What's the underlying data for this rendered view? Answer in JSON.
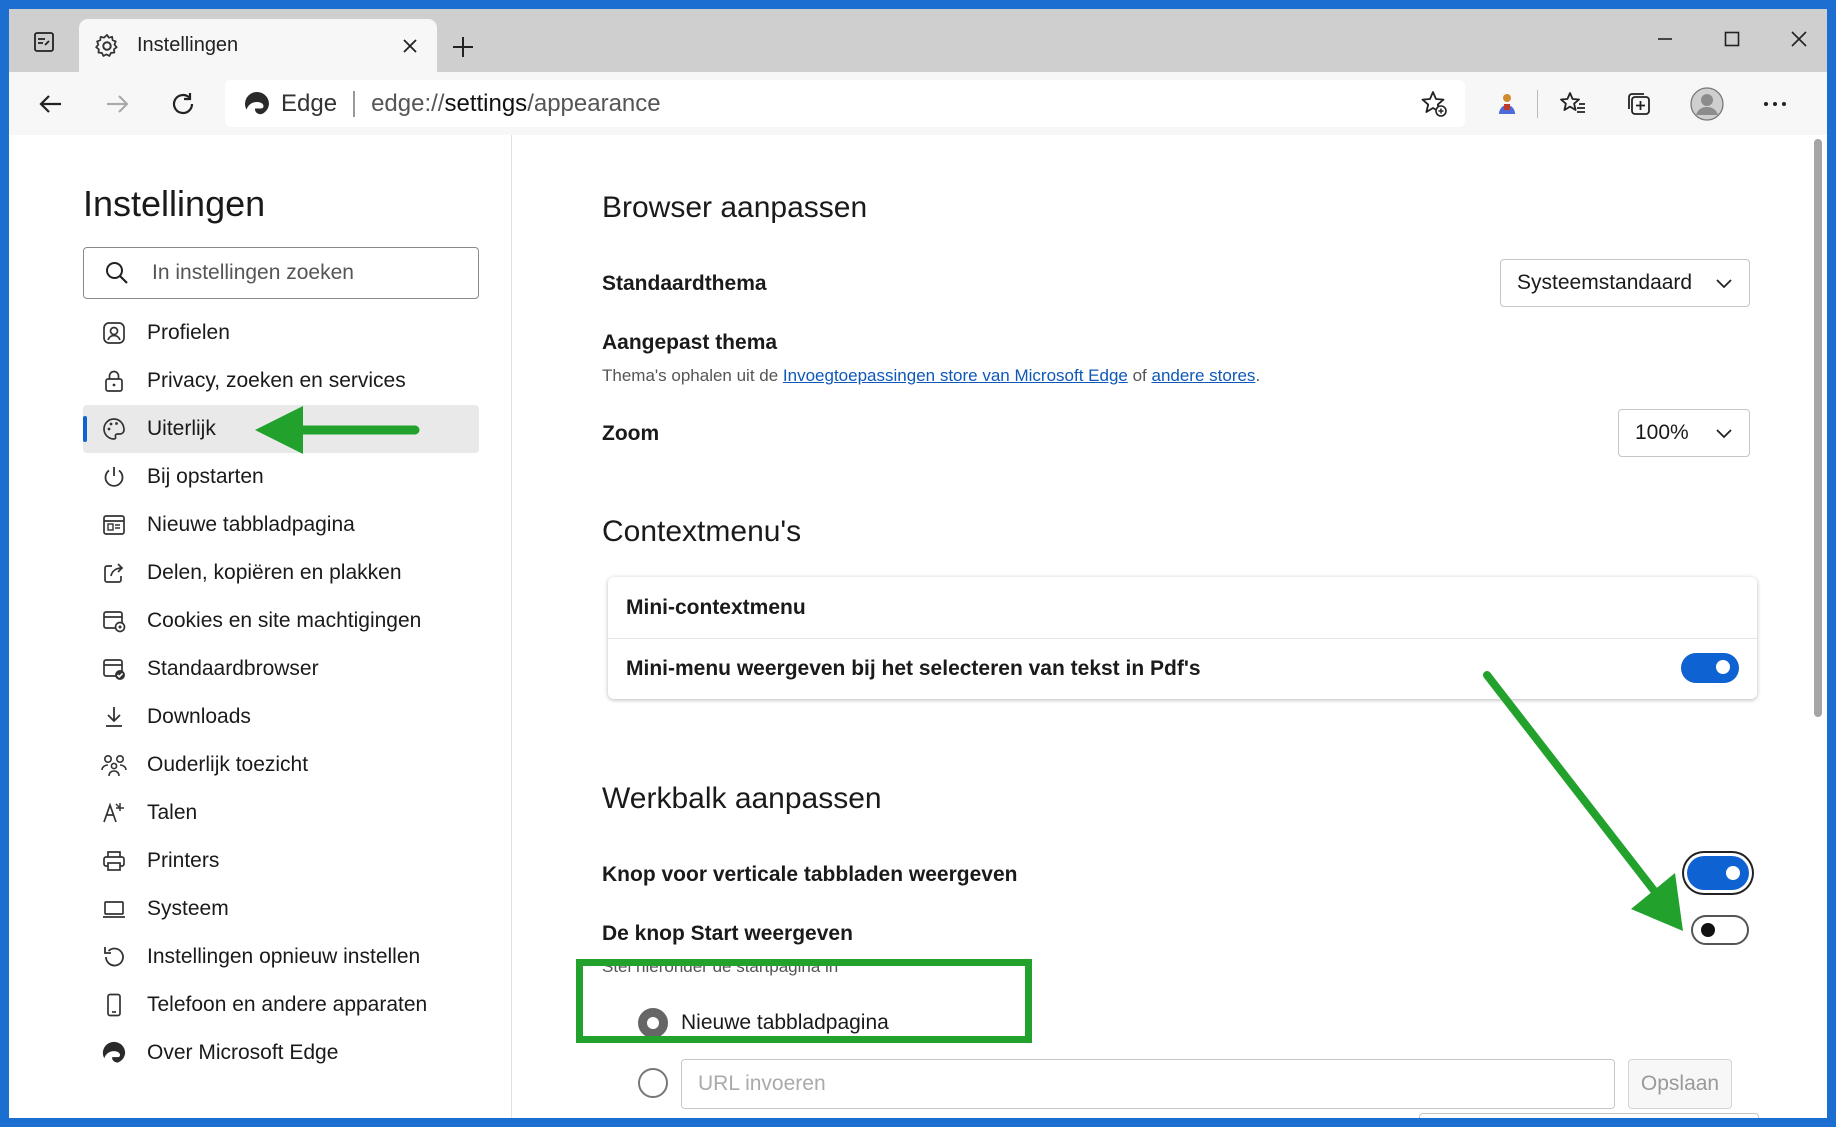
{
  "window": {
    "tab_title": "Instellingen"
  },
  "address_bar": {
    "site_label": "Edge",
    "url_scheme": "edge://",
    "url_host": "settings",
    "url_path": "/appearance"
  },
  "sidebar": {
    "title": "Instellingen",
    "search_placeholder": "In instellingen zoeken",
    "active_item": "Uiterlijk",
    "items": [
      {
        "label": "Profielen",
        "icon": "profile-icon"
      },
      {
        "label": "Privacy, zoeken en services",
        "icon": "lock-icon"
      },
      {
        "label": "Uiterlijk",
        "icon": "palette-icon"
      },
      {
        "label": "Bij opstarten",
        "icon": "power-icon"
      },
      {
        "label": "Nieuwe tabbladpagina",
        "icon": "newtab-page-icon"
      },
      {
        "label": "Delen, kopiëren en plakken",
        "icon": "share-icon"
      },
      {
        "label": "Cookies en site machtigingen",
        "icon": "cookies-icon"
      },
      {
        "label": "Standaardbrowser",
        "icon": "default-browser-icon"
      },
      {
        "label": "Downloads",
        "icon": "download-icon"
      },
      {
        "label": "Ouderlijk toezicht",
        "icon": "family-icon"
      },
      {
        "label": "Talen",
        "icon": "languages-icon"
      },
      {
        "label": "Printers",
        "icon": "printer-icon"
      },
      {
        "label": "Systeem",
        "icon": "system-icon"
      },
      {
        "label": "Instellingen opnieuw instellen",
        "icon": "reset-icon"
      },
      {
        "label": "Telefoon en andere apparaten",
        "icon": "phone-icon"
      },
      {
        "label": "Over Microsoft Edge",
        "icon": "edge-logo-icon"
      }
    ]
  },
  "main": {
    "browser_section": {
      "title": "Browser aanpassen",
      "default_theme_label": "Standaardthema",
      "default_theme_value": "Systeemstandaard",
      "custom_theme_label": "Aangepast thema",
      "custom_theme_text_1": "Thema's ophalen uit de ",
      "custom_theme_link_1": "Invoegtoepassingen store van Microsoft Edge",
      "custom_theme_text_2": " of ",
      "custom_theme_link_2": "andere stores",
      "custom_theme_text_3": ".",
      "zoom_label": "Zoom",
      "zoom_value": "100%"
    },
    "context_section": {
      "title": "Contextmenu's",
      "card_title": "Mini-contextmenu",
      "pdf_label": "Mini-menu weergeven bij het selecteren van tekst in Pdf's",
      "pdf_toggle_on": true
    },
    "toolbar_section": {
      "title": "Werkbalk aanpassen",
      "vertical_tabs_label": "Knop voor verticale tabbladen weergeven",
      "vertical_tabs_on": true,
      "home_label": "De knop Start weergeven",
      "home_on": false,
      "home_sub": "Stel hieronder de startpagina in",
      "radio_newtab_label": "Nieuwe tabbladpagina",
      "url_placeholder": "URL invoeren",
      "save_label": "Opslaan"
    }
  },
  "annotations": {
    "arrow_color": "#22a22d",
    "highlight_color": "#22a22d"
  },
  "colors": {
    "accent": "#0f62d1",
    "link": "#0f58b8"
  }
}
